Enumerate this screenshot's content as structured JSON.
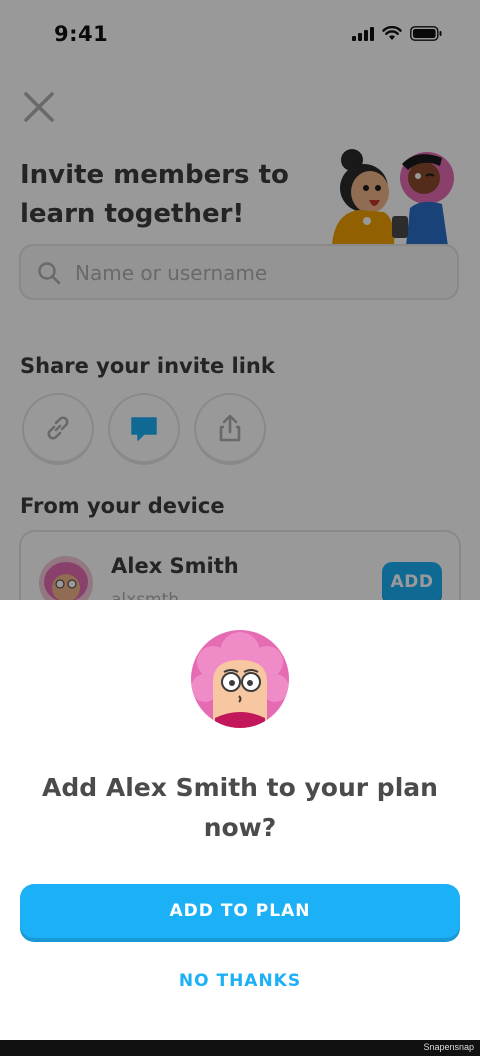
{
  "status_bar": {
    "time": "9:41"
  },
  "header": {
    "title": "Invite members to learn together!"
  },
  "search": {
    "placeholder": "Name or username"
  },
  "share": {
    "section_title": "Share your invite link",
    "buttons": [
      {
        "icon": "link-icon"
      },
      {
        "icon": "message-icon",
        "accent": "#1cb0f6"
      },
      {
        "icon": "share-icon"
      }
    ]
  },
  "device": {
    "section_title": "From your device",
    "contacts": [
      {
        "name": "Alex Smith",
        "username": "alxsmth",
        "add_label": "ADD"
      }
    ]
  },
  "modal": {
    "title": "Add Alex Smith to your plan now?",
    "primary_label": "ADD TO PLAN",
    "secondary_label": "NO THANKS"
  },
  "colors": {
    "accent": "#1cb0f6",
    "accent_shadow": "#1899d6",
    "text": "#4b4b4b"
  },
  "watermark": "Snapensnap"
}
